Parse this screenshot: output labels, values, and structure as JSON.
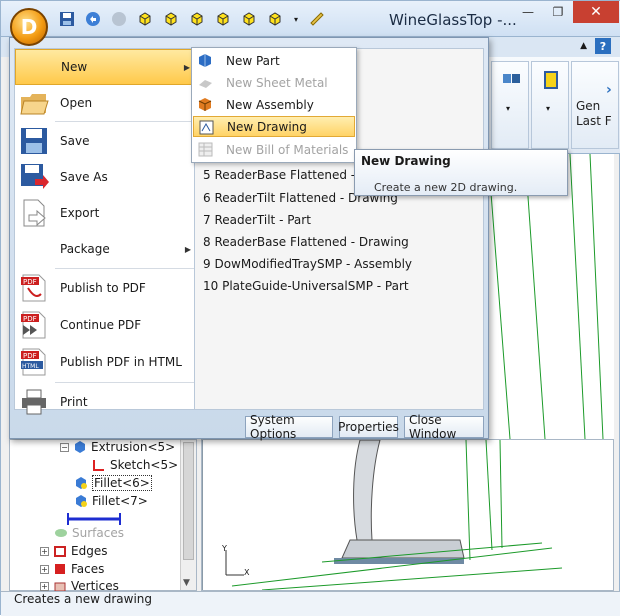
{
  "window": {
    "title": "WineGlassTop -...",
    "app_button_glyph": "D"
  },
  "ribbon": {
    "gen_label_line1": "Gen",
    "gen_label_line2": "Last F"
  },
  "app_menu": {
    "items": [
      {
        "label": "New",
        "icon": "new-icon",
        "has_submenu": true,
        "active": true
      },
      {
        "label": "Open",
        "icon": "open-folder-icon"
      },
      {
        "label": "Save",
        "icon": "save-icon"
      },
      {
        "label": "Save As",
        "icon": "save-as-icon"
      },
      {
        "label": "Export",
        "icon": "export-icon"
      },
      {
        "label": "Package",
        "icon": "package-icon",
        "has_submenu": true
      },
      {
        "label": "Publish to PDF",
        "icon": "pdf-icon"
      },
      {
        "label": "Continue PDF",
        "icon": "continue-pdf-icon"
      },
      {
        "label": "Publish PDF in HTML",
        "icon": "pdf-html-icon"
      },
      {
        "label": "Print",
        "icon": "printer-icon"
      }
    ],
    "recent": [
      "5 ReaderBase Flattened - Part",
      "6 ReaderTilt Flattened - Drawing",
      "7 ReaderTilt - Part",
      "8 ReaderBase Flattened - Drawing",
      "9 DowModifiedTraySMP - Assembly",
      "10 PlateGuide-UniversalSMP - Part"
    ],
    "footer": {
      "system_options": "System Options",
      "properties": "Properties",
      "close_window": "Close Window"
    }
  },
  "submenu_new": {
    "items": [
      {
        "label": "New Part",
        "disabled": false
      },
      {
        "label": "New Sheet Metal",
        "disabled": true
      },
      {
        "label": "New Assembly",
        "disabled": false
      },
      {
        "label": "New Drawing",
        "disabled": false,
        "active": true
      },
      {
        "label": "New Bill of Materials",
        "disabled": true
      }
    ]
  },
  "tooltip": {
    "title": "New Drawing",
    "description": "Create a new 2D drawing."
  },
  "tree": {
    "items": [
      {
        "label": "Extrusion<5>",
        "icon": "extrusion-icon"
      },
      {
        "label": "Sketch<5>",
        "icon": "sketch-icon"
      },
      {
        "label": "Fillet<6>",
        "icon": "fillet-icon"
      },
      {
        "label": "Fillet<7>",
        "icon": "fillet-icon"
      },
      {
        "label": "Surfaces",
        "icon": "surfaces-icon"
      },
      {
        "label": "Edges",
        "icon": "edges-icon"
      },
      {
        "label": "Faces",
        "icon": "faces-icon"
      },
      {
        "label": "Vertices",
        "icon": "vertices-icon"
      }
    ]
  },
  "viewport": {
    "axis_y": "Y",
    "axis_x": "X"
  },
  "status": {
    "text": "Creates a new drawing"
  },
  "colors": {
    "menu_highlight": "#ffc94a",
    "close_button": "#c84031",
    "frame": "#9ab4cf"
  }
}
